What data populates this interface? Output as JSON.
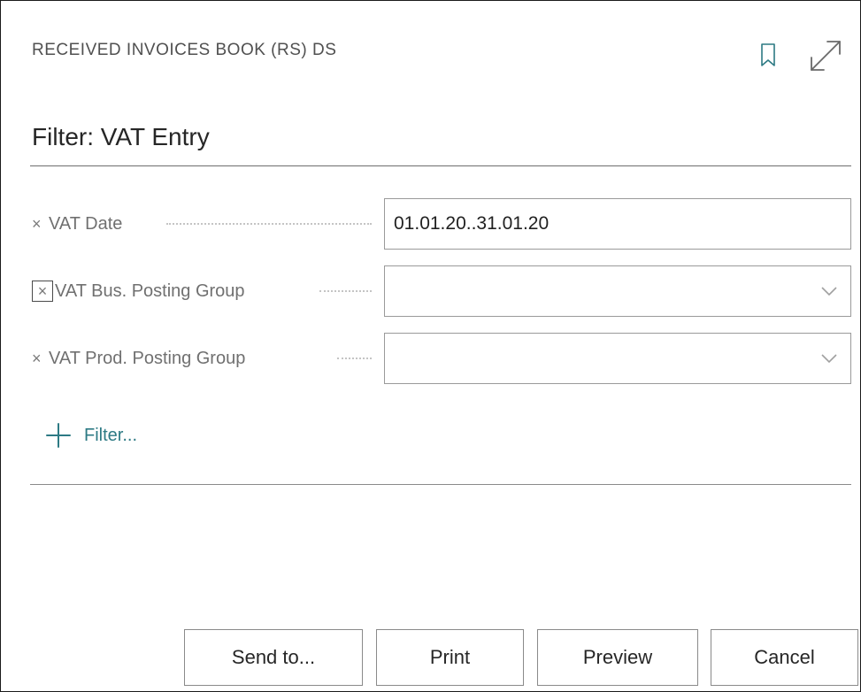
{
  "dialog": {
    "title": "RECEIVED INVOICES BOOK (RS) DS",
    "accent_color": "#2d7a84"
  },
  "section": {
    "title": "Filter: VAT Entry"
  },
  "filters": [
    {
      "remove_glyph": "×",
      "label": "VAT Date",
      "value": "01.01.20..31.01.20",
      "type": "text"
    },
    {
      "remove_glyph": "×",
      "label": "VAT Bus. Posting Group",
      "value": "",
      "type": "select"
    },
    {
      "remove_glyph": "×",
      "label": "VAT Prod. Posting Group",
      "value": "",
      "type": "select"
    }
  ],
  "add_filter": {
    "label": "Filter..."
  },
  "buttons": {
    "send_to": "Send to...",
    "print": "Print",
    "preview": "Preview",
    "cancel": "Cancel"
  },
  "icons": {
    "bookmark": "bookmark-icon",
    "expand": "expand-icon",
    "remove": "close-icon",
    "dropdown": "chevron-down-icon",
    "add": "plus-icon"
  }
}
